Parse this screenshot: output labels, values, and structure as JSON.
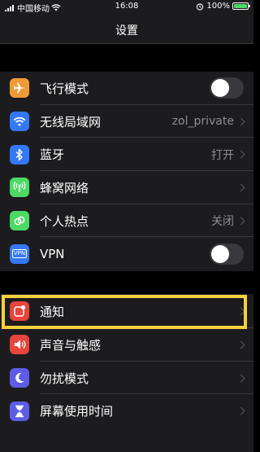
{
  "status_bar": {
    "carrier": "中国移动",
    "time": "16:08",
    "battery_text": "100%",
    "battery_color": "#4cd964"
  },
  "nav": {
    "title": "设置"
  },
  "groups": [
    {
      "rows": [
        {
          "label": "飞行模式",
          "icon": "airplane-icon",
          "icon_color": "#f09a37",
          "control": "toggle",
          "toggle_on": false
        },
        {
          "label": "无线局域网",
          "icon": "wifi-icon",
          "icon_color": "#3478f6",
          "value": "zol_private",
          "control": "chevron"
        },
        {
          "label": "蓝牙",
          "icon": "bluetooth-icon",
          "icon_color": "#3478f6",
          "value": "打开",
          "control": "chevron"
        },
        {
          "label": "蜂窝网络",
          "icon": "antenna-icon",
          "icon_color": "#4cd964",
          "control": "chevron"
        },
        {
          "label": "个人热点",
          "icon": "hotspot-icon",
          "icon_color": "#4cd964",
          "value": "关闭",
          "control": "chevron"
        },
        {
          "label": "VPN",
          "icon_text": "VPN",
          "icon": "vpn-icon",
          "icon_color": "#3478f6",
          "control": "toggle",
          "toggle_on": false
        }
      ]
    },
    {
      "rows": [
        {
          "label": "通知",
          "icon": "notification-icon",
          "icon_color": "#e5453c",
          "control": "chevron"
        },
        {
          "label": "声音与触感",
          "icon": "speaker-icon",
          "icon_color": "#e5453c",
          "control": "chevron"
        },
        {
          "label": "勿扰模式",
          "icon": "moon-icon",
          "icon_color": "#5e5ce6",
          "control": "chevron"
        },
        {
          "label": "屏幕使用时间",
          "icon": "hourglass-icon",
          "icon_color": "#5e5ce6",
          "control": "chevron"
        }
      ]
    }
  ],
  "highlight_color": "#f4d03f"
}
